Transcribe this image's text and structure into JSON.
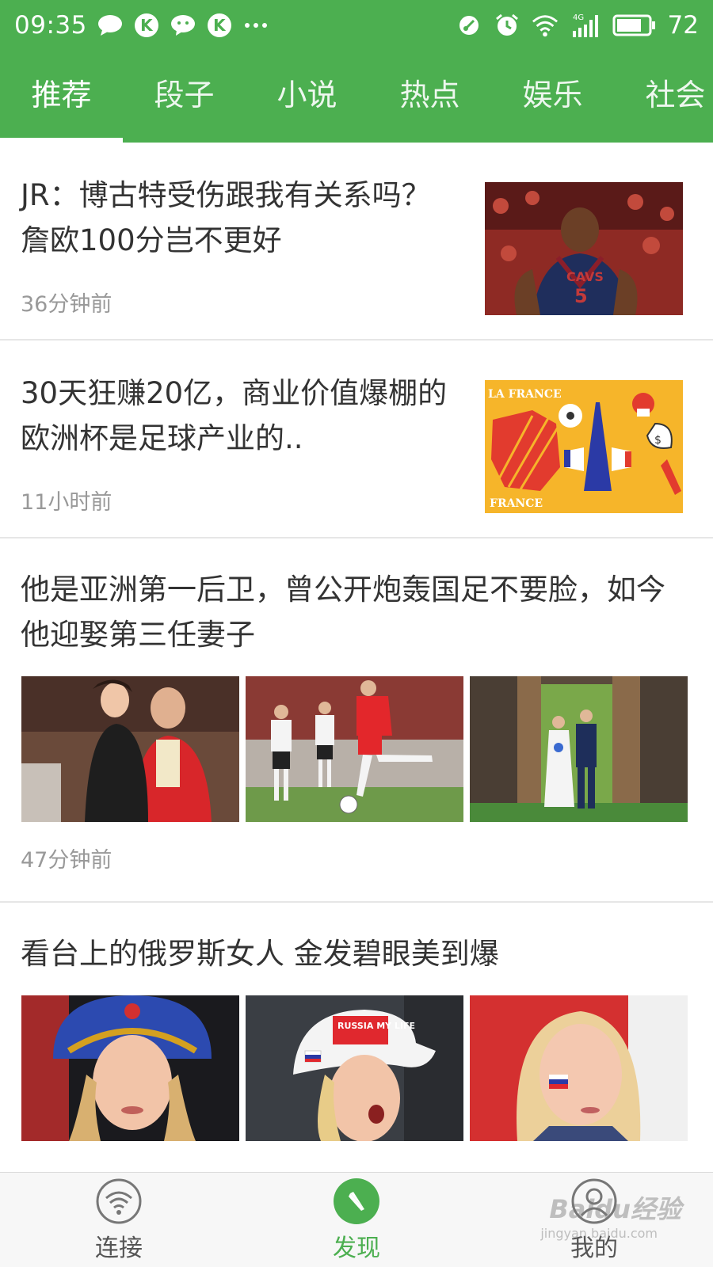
{
  "status_bar": {
    "time": "09:35",
    "battery": "72",
    "network": "4G",
    "left_icons": [
      "message-icon",
      "k-app-icon",
      "chat-icon",
      "k-app-icon",
      "more-dots-icon"
    ],
    "right_icons": [
      "hotspot-icon",
      "alarm-icon",
      "wifi-icon",
      "signal-icon",
      "battery-icon"
    ]
  },
  "tabs": [
    {
      "label": "推荐",
      "active": true
    },
    {
      "label": "段子",
      "active": false
    },
    {
      "label": "小说",
      "active": false
    },
    {
      "label": "热点",
      "active": false
    },
    {
      "label": "娱乐",
      "active": false
    },
    {
      "label": "社会",
      "active": false
    }
  ],
  "feed": [
    {
      "layout": "single-image",
      "title": "JR：博古特受伤跟我有关系吗？詹欧100分岂不更好",
      "time": "36分钟前",
      "image": "basketball-player-photo"
    },
    {
      "layout": "single-image",
      "title": "30天狂赚20亿，商业价值爆棚的欧洲杯是足球产业的..",
      "time": "11小时前",
      "image": "france-illustration",
      "image_text": [
        "LA FRANCE",
        "FRANCE"
      ]
    },
    {
      "layout": "three-images",
      "title": "他是亚洲第一后卫，曾公开炮轰国足不要脸，如今他迎娶第三任妻子",
      "time": "47分钟前",
      "images": [
        "couple-photo",
        "football-match-photo",
        "wedding-photo"
      ]
    },
    {
      "layout": "three-images",
      "title": "看台上的俄罗斯女人 金发碧眼美到爆",
      "time": "",
      "images": [
        "fan-headdress-photo",
        "fan-cap-photo",
        "fan-flag-photo"
      ],
      "cap_text": "RUSSIA MY LIFE"
    }
  ],
  "bottom_nav": [
    {
      "label": "连接",
      "icon": "wifi-circle-icon",
      "active": false
    },
    {
      "label": "发现",
      "icon": "compass-icon",
      "active": true
    },
    {
      "label": "我的",
      "icon": "profile-icon",
      "active": false
    }
  ],
  "watermark": {
    "text": "Baidu经验",
    "sub": "jingyan.baidu.com"
  },
  "colors": {
    "brand_green": "#4caf50",
    "text": "#333333",
    "muted": "#999999"
  }
}
